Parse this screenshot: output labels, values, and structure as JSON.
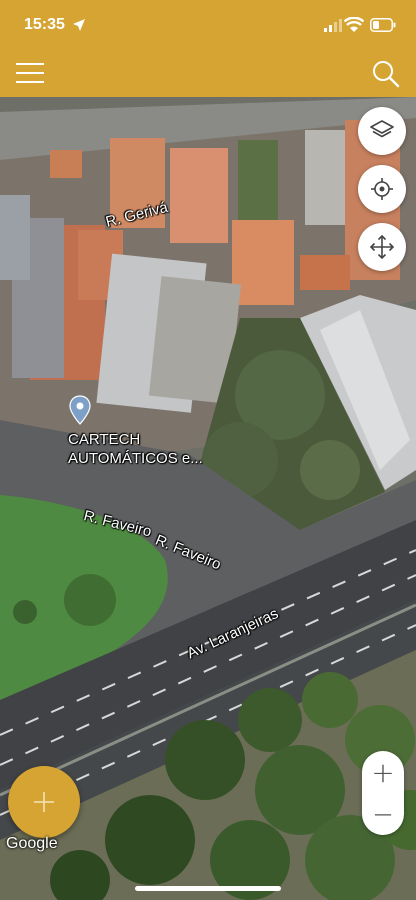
{
  "status_bar": {
    "time": "15:35"
  },
  "header": {
    "menu_icon": "hamburger-menu-icon",
    "search_icon": "search-icon",
    "background": "#D6A432"
  },
  "map": {
    "labels": {
      "street_gerivá": "R. Gerivá",
      "street_faveiro_1": "R. Faveiro",
      "street_faveiro_2": "R. Faveiro",
      "avenue_laranjeiras": "Av. Laranjeiras",
      "poi_name_line1": "CARTECH",
      "poi_name_line2": "AUTOMÁTICOS e..."
    },
    "attribution": "Google"
  },
  "controls": {
    "layers_icon": "layers-icon",
    "locate_icon": "crosshair-icon",
    "move_icon": "move-arrows-icon",
    "zoom_in": "+",
    "zoom_out": "—",
    "fab_icon": "plus-icon",
    "fab_color": "#D6A432"
  }
}
